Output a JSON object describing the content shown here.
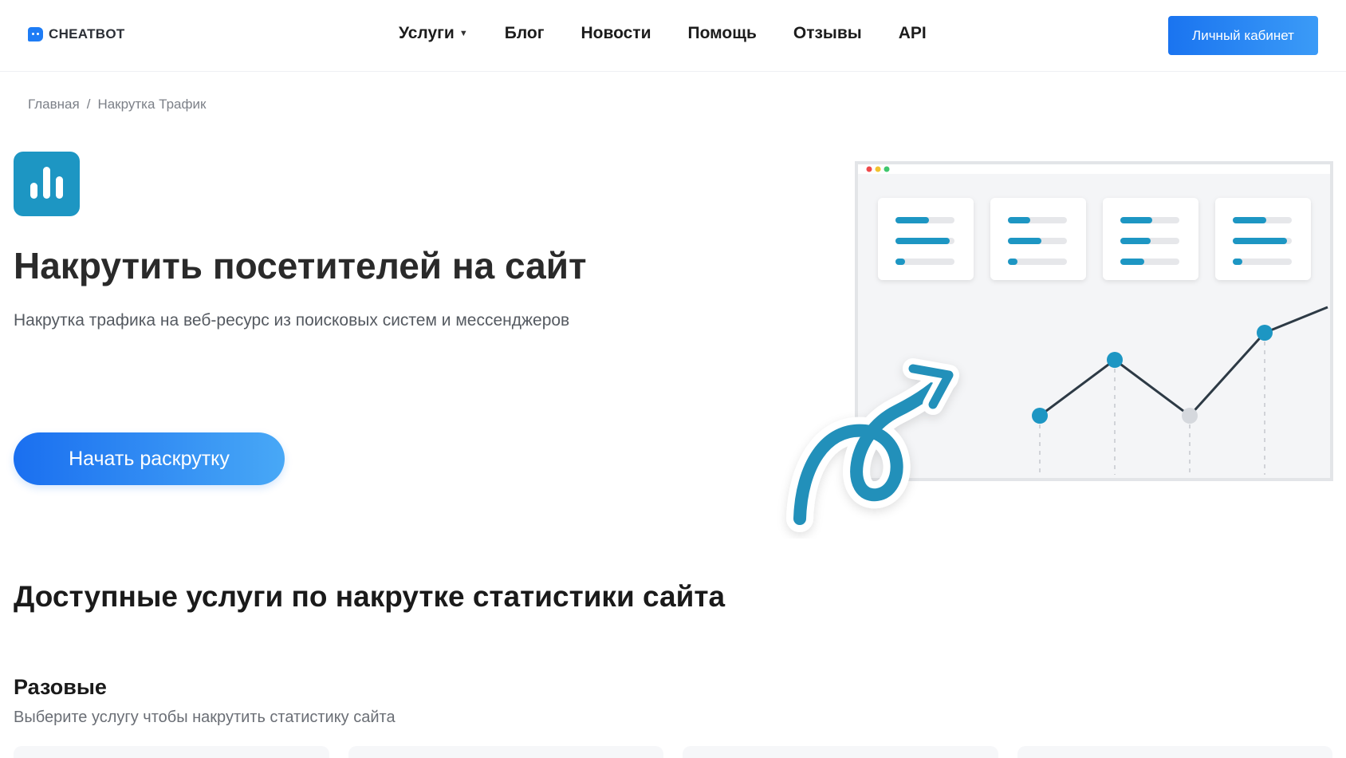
{
  "header": {
    "logo_text": "CHEATBOT",
    "nav": [
      {
        "label": "Услуги",
        "has_dropdown": true
      },
      {
        "label": "Блог"
      },
      {
        "label": "Новости"
      },
      {
        "label": "Помощь"
      },
      {
        "label": "Отзывы"
      },
      {
        "label": "API"
      }
    ],
    "cabinet_label": "Личный кабинет"
  },
  "breadcrumb": {
    "home": "Главная",
    "separator": "/",
    "current": "Накрутка Трафик"
  },
  "hero": {
    "icon": "bar-chart-icon",
    "title": "Накрутить посетителей на сайт",
    "subtitle": "Накрутка трафика на веб-ресурс из поисковых систем и мессенджеров",
    "cta_label": "Начать раскрутку"
  },
  "services": {
    "title": "Доступные услуги по накрутке статистики сайта",
    "subtitle": "Разовые",
    "description": "Выберите услугу чтобы накрутить статистику сайта",
    "card_count": 4
  },
  "colors": {
    "accent_blue": "#1a74f0",
    "teal": "#1d96c3",
    "text_dark": "#2a2a2a"
  }
}
